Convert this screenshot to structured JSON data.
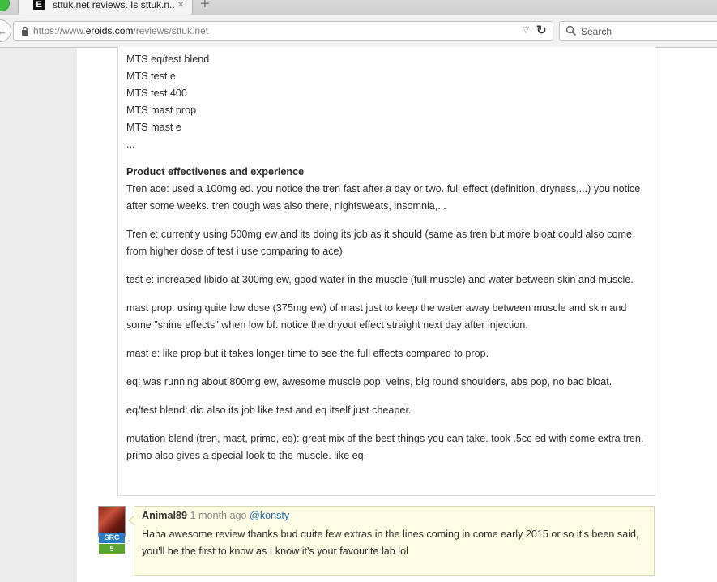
{
  "browser": {
    "tab_title": "sttuk.net reviews. Is sttuk.n...",
    "tab_favicon": "E",
    "tab_close": "×",
    "new_tab": "+",
    "url_prefix": "https://www.",
    "url_domain": "eroids.com",
    "url_path": "/reviews/sttuk.net",
    "search_placeholder": "Search"
  },
  "review": {
    "products": [
      "MTS eq/test blend",
      "MTS test e",
      "MTS test 400",
      "MTS mast prop",
      "MTS mast e",
      "..."
    ],
    "section_heading": "Product effectivenes and experience",
    "paragraphs": [
      "Tren ace: used a 100mg ed. you notice the tren fast after a day or two. full effect (definition, dryness,...) you notice after some weeks. tren cough was also there, nightsweats, insomnia,...",
      "Tren e: currently using 500mg ew and its doing its job as it should (same as tren but more bloat could also come from higher dose of test i use comparing to ace)",
      "test e: increased libido at 300mg ew, good water in the muscle (full muscle) and water between skin and muscle.",
      "mast prop: using quite low dose (375mg ew) of mast just to keep the water away between muscle and skin and some \"shine effects\" when low bf. notice the dryout effect straight next day after injection.",
      "mast e: like prop but it takes longer time to see the full effects compared to prop.",
      "eq: was running about 800mg ew, awesome muscle pop, veins, big round shoulders, abs pop, no bad bloat.",
      "eq/test blend: did also its job like test and eq itself just cheaper.",
      "mutation blend (tren, mast, primo, eq): great mix of the best things you can take. took .5cc ed with some extra tren. primo also gives a special look to the muscle. like eq."
    ]
  },
  "comment": {
    "author": "Animal89",
    "time": "1 month ago",
    "mention": "@konsty",
    "badge_label": "SRC",
    "badge_score": "5",
    "body": "Haha awesome review thanks bud quite few extras in the lines coming in come early 2015 or so it's been said, you'll be the first to know as I know it's your favourite lab lol"
  },
  "colors": {
    "comment_bg": "#fdfde3",
    "src_badge": "#2e7bc4",
    "score_badge": "#5aa52b",
    "mention": "#2a6fb3"
  },
  "icons": [
    "lock-icon",
    "dropdown-icon",
    "reload-icon",
    "search-icon",
    "close-icon",
    "plus-icon",
    "back-arrow-icon"
  ]
}
